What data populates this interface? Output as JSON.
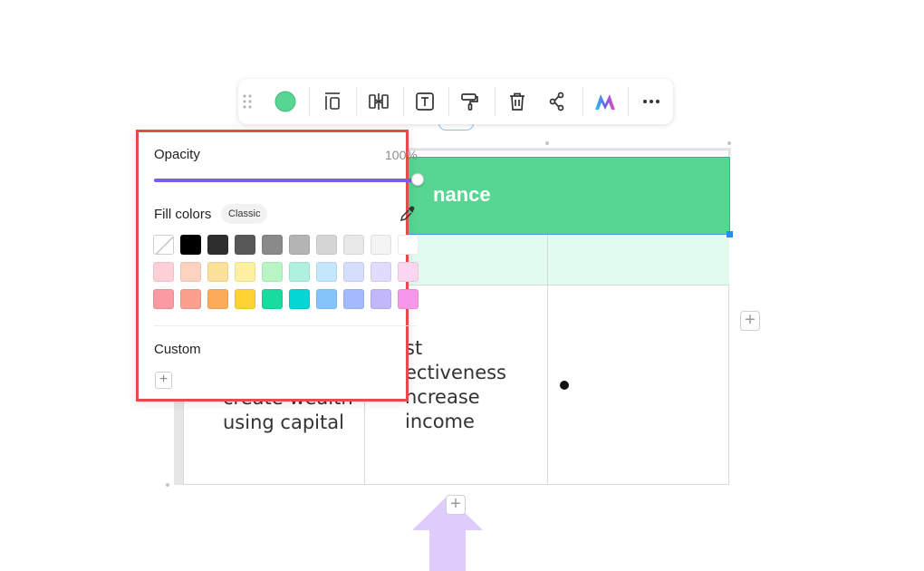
{
  "toolbar": {
    "color_dot": "#57d592",
    "icons": [
      "drag-handle-icon",
      "fill-color-icon",
      "align-icon",
      "distribute-icon",
      "text-icon",
      "format-painter-icon",
      "delete-icon",
      "connector-icon",
      "ai-logo-icon",
      "more-icon"
    ]
  },
  "table": {
    "header_text": "nance",
    "cells": [
      {
        "text": "create wealth\nusing capital"
      },
      {
        "text": "st\nectiveness\nncrease\nincome"
      }
    ],
    "colors": {
      "header": "#57d592",
      "subrow": "#e2fbef",
      "selection": "#2a8cf0"
    }
  },
  "color_panel": {
    "opacity_label": "Opacity",
    "opacity_value": "100%",
    "opacity_level": 1.0,
    "fill_label": "Fill colors",
    "palette_badge": "Classic",
    "custom_label": "Custom",
    "custom_add": "+",
    "swatches": [
      [
        "none",
        "#000000",
        "#2e2e2e",
        "#585858",
        "#8a8a8a",
        "#b4b4b4",
        "#d6d6d6",
        "#e8e8e8",
        "#f3f3f3",
        "#ffffff"
      ],
      [
        "#fdd0d8",
        "#fdd3bf",
        "#fde09a",
        "#fdf0a0",
        "#b8f5c4",
        "#b0f0de",
        "#c3e7fd",
        "#d5dffd",
        "#e1dcfd",
        "#fbd6f1"
      ],
      [
        "#fb9aa3",
        "#fba08e",
        "#fbac5a",
        "#fdd434",
        "#18dba0",
        "#05d7d7",
        "#85c4fb",
        "#a3bbfc",
        "#c1b7fa",
        "#f697ea"
      ]
    ],
    "border_color": "#e54b4b",
    "slider_color": "#7b5cf0"
  },
  "canvas": {
    "add_plus": "+",
    "arrow_color": "#dfccfd"
  }
}
